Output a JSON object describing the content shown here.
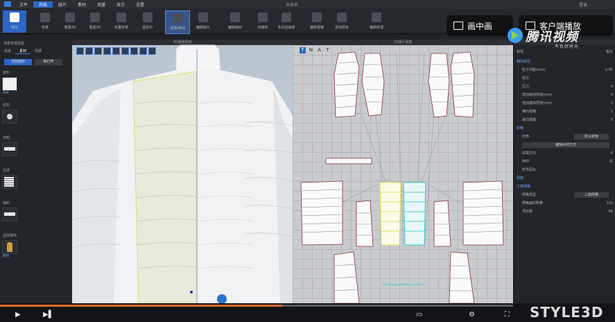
{
  "menu": {
    "items": [
      "文件",
      "开始",
      "版片",
      "素材",
      "测量",
      "显示",
      "设置"
    ],
    "active_index": 1,
    "document": "未命名",
    "right": "登录"
  },
  "ribbon": {
    "buttons": [
      "模拟",
      "安排",
      "重置2D",
      "重置3D",
      "折叠安排",
      "固定针",
      "选择/移动",
      "编辑版片",
      "编辑缝纫",
      "线缝纫",
      "多段自由缝",
      "编辑褶皱",
      "添加层级",
      "编辑纹理"
    ]
  },
  "left_panel": {
    "title": "场景管理视窗",
    "tabs": [
      "场景",
      "素材",
      "周期"
    ],
    "active_tab_index": 1,
    "buttons": [
      "当前面料",
      "新打开"
    ],
    "items": [
      {
        "label": "面料",
        "thumb": "白布",
        "type": "white"
      },
      {
        "label": "纽扣",
        "thumb": "",
        "type": "button"
      },
      {
        "label": "扣眼",
        "thumb": "",
        "type": "dark"
      },
      {
        "label": "拉链",
        "thumb": "",
        "type": "stripes"
      },
      {
        "label": "辅料",
        "thumb": "",
        "type": "dark"
      },
      {
        "label": "虚拟模特",
        "thumb": "模特",
        "type": "avatar"
      }
    ]
  },
  "view3d": {
    "title": "3D服装视窗"
  },
  "view2d": {
    "title": "2D版片视窗",
    "tools": [
      "T",
      "N",
      "A",
      "T"
    ]
  },
  "right_panel": {
    "title_left": "属性",
    "title_right": "板片",
    "rows": [
      {
        "label": "模拟属性",
        "value": "",
        "type": "sec"
      },
      {
        "label": "粒子间距(mm)",
        "value": "0.05"
      },
      {
        "label": "层次",
        "value": ""
      },
      {
        "label": "压力",
        "value": "0"
      },
      {
        "label": "增加缝纫厚度(mm)",
        "value": "0"
      },
      {
        "label": "增加模拟厚度(mm)",
        "value": "2"
      },
      {
        "label": "横向褶皱",
        "value": "1"
      },
      {
        "label": "纵向褶皱",
        "value": "0"
      },
      {
        "label": "织物",
        "value": "",
        "type": "sec"
      },
      {
        "label": "织物",
        "value": "默认织物",
        "type": "box"
      },
      {
        "label": "编辑纱线方式",
        "value": "",
        "type": "bar"
      },
      {
        "label": "纹理方向",
        "value": "0"
      },
      {
        "label": "MRT",
        "value": "关"
      },
      {
        "label": "形态固化",
        "value": ""
      },
      {
        "label": "网格",
        "value": "",
        "type": "sec"
      },
      {
        "label": "三角网格",
        "value": "",
        "type": "sec"
      },
      {
        "label": "网格类型",
        "value": "三角网格",
        "type": "box"
      },
      {
        "label": "网格面的数量",
        "value": "132"
      },
      {
        "label": "顶点数",
        "value": "68"
      }
    ]
  },
  "overlay": {
    "pip": "画中画",
    "client": "客户端播放",
    "watermark_name": "腾讯视频",
    "watermark_slogan": "不负好时光"
  },
  "player": {
    "progress": 0.55,
    "brand": "STYLE3D"
  }
}
